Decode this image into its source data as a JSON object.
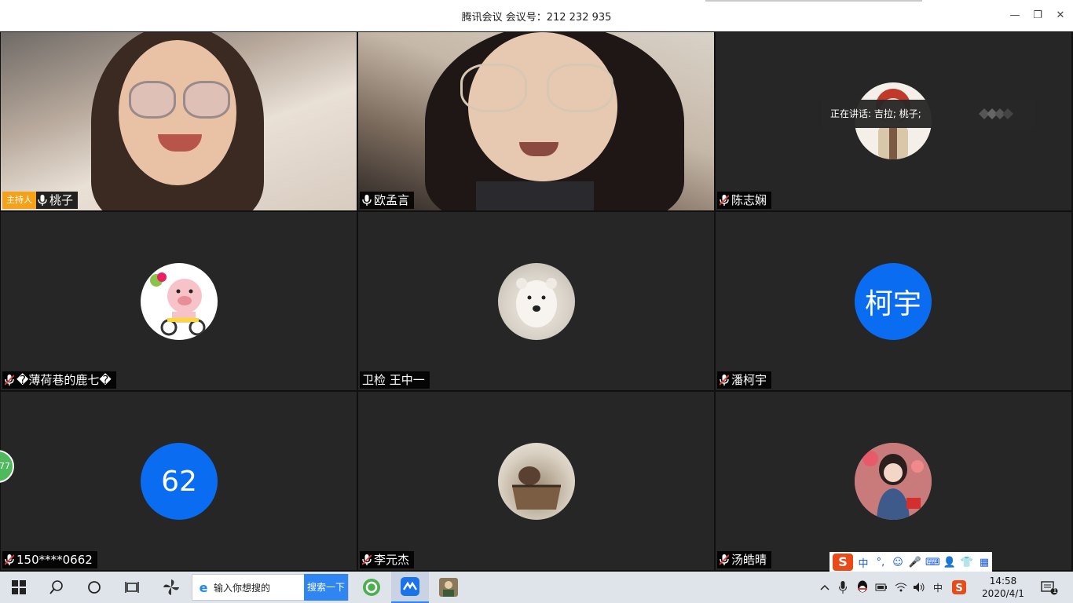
{
  "window": {
    "title": "腾讯会议 会议号：212 232 935",
    "minimize_label": "—",
    "restore_label": "❐",
    "close_label": "✕"
  },
  "speaking_banner": {
    "text": "正在讲话: 吉拉; 桃子;"
  },
  "host_badge": "主持人",
  "participants": [
    {
      "name": "桃子",
      "type": "video",
      "mic": "on",
      "host": true
    },
    {
      "name": "欧孟言",
      "type": "video",
      "mic": "on"
    },
    {
      "name": "陈志娴",
      "type": "avatar",
      "avatar": "cartoon-girl-icon",
      "mic": "muted"
    },
    {
      "name": "�薄荷巷的鹿七�",
      "type": "avatar",
      "avatar": "pig-bicycle-icon",
      "mic": "muted"
    },
    {
      "name": "卫检 王中一",
      "type": "avatar",
      "avatar": "polar-bear-icon",
      "mic": "none"
    },
    {
      "name": "潘柯宇",
      "type": "initials",
      "initials": "柯宇",
      "mic": "muted"
    },
    {
      "name": "150****0662",
      "type": "initials",
      "initials": "62",
      "mic": "muted"
    },
    {
      "name": "李元杰",
      "type": "avatar",
      "avatar": "cat-basket-icon",
      "mic": "muted"
    },
    {
      "name": "汤皓晴",
      "type": "avatar",
      "avatar": "girl-portrait-icon",
      "mic": "muted"
    }
  ],
  "side_bubble": {
    "text": "77"
  },
  "ime_bar": {
    "logo": "S",
    "items": [
      "中",
      "°,",
      "☺",
      "🎤",
      "⌨",
      "👤",
      "👕",
      "▦"
    ]
  },
  "taskbar": {
    "search_placeholder": "输入你想搜的",
    "search_button": "搜索一下",
    "tray_lang": "中",
    "time": "14:58",
    "date": "2020/4/1",
    "notification_count": "1"
  },
  "colors": {
    "host_badge": "#f3a21a",
    "initials_avatar": "#0a6cf0",
    "tile_bg": "#262626",
    "taskbar_bg": "#dfe3ea",
    "search_button_bg": "#2f86f3"
  }
}
